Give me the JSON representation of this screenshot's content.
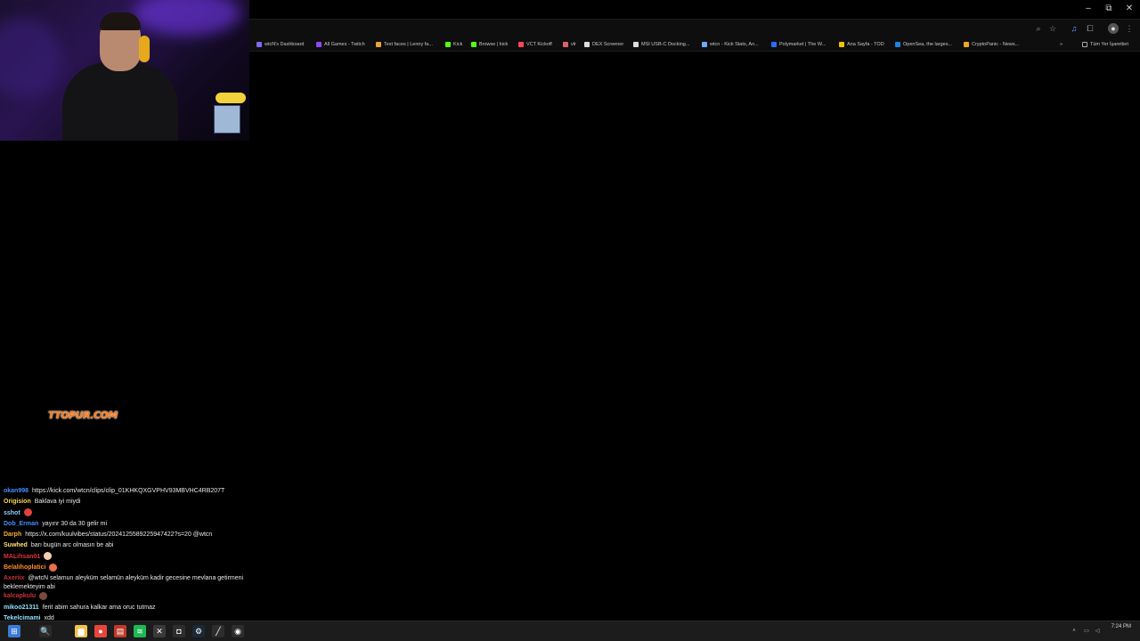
{
  "browser": {
    "window_controls": {
      "minimize": "–",
      "maximize": "⧉",
      "close": "✕"
    },
    "toolbar_icons": [
      "zoom-icon",
      "star-icon",
      "media-icon",
      "extensions-icon",
      "profile-icon",
      "menu-icon"
    ],
    "bookmarks": [
      {
        "label": "wtcN's Dashboard",
        "color": "#7c6af2"
      },
      {
        "label": "All Games - Twitch",
        "color": "#9146ff"
      },
      {
        "label": "Text faces | Lenny fa...",
        "color": "#e8a33a"
      },
      {
        "label": "Kick",
        "color": "#53fc18"
      },
      {
        "label": "Browse | kick",
        "color": "#53fc18"
      },
      {
        "label": "VCT Kickoff",
        "color": "#ff4655"
      },
      {
        "label": "vlr",
        "color": "#da626c"
      },
      {
        "label": "DEX Screener",
        "color": "#dcdcdc"
      },
      {
        "label": "MSI USB-C Docking...",
        "color": "#dcdcdc"
      },
      {
        "label": "wtcn - Kick Stats, An...",
        "color": "#6fa8ff"
      },
      {
        "label": "Polymarket | The W...",
        "color": "#2d6cf6"
      },
      {
        "label": "Ana Sayfa - TOD",
        "color": "#f2c200"
      },
      {
        "label": "OpenSea, the larges...",
        "color": "#2081e2"
      },
      {
        "label": "CryptoPanic - News...",
        "color": "#f5a623"
      }
    ],
    "bookmarks_overflow": "»",
    "all_bookmarks": "Tüm Yer İşaretleri"
  },
  "overlay": {
    "logo_text": "TTOPUR.COM"
  },
  "chat": {
    "messages": [
      {
        "user": "okan998",
        "color": "#4a8cff",
        "text": "https://kick.com/wtcn/clips/clip_01KHKQXGVPHV93MBVHC4RB207T"
      },
      {
        "user": "Origision",
        "color": "#ffd84a",
        "text": "Baklava iyi miydi"
      },
      {
        "user": "sshot",
        "color": "#8fd0ff",
        "text": "",
        "emote": "#e04040"
      },
      {
        "user": "Dob_Erman",
        "color": "#4a8cff",
        "text": "yayınr 30 da 30 gelir mi"
      },
      {
        "user": "Darph",
        "color": "#ffb03a",
        "text": "https://x.com/kuulvibes/status/2024125589225947422?s=20 @wtcn"
      },
      {
        "user": "Suwhed",
        "color": "#ffe06a",
        "text": "barı bugün arc olmasın be abi"
      },
      {
        "user": "MALihsan01",
        "color": "#e0303a",
        "text": "",
        "emote": "#f5d0b0"
      },
      {
        "user": "Belalihoplatici",
        "color": "#ff8a2a",
        "text": "",
        "emote": "#e8704a"
      },
      {
        "user": "Axeriix",
        "color": "#c8323a",
        "text": "@wtcN selamun aleyküm selamün aleyküm kadir gecesine mevlana getirmeni beklemekteyim abi",
        "wrap": true
      },
      {
        "user": "kalcapkulu",
        "color": "#c8323a",
        "text": "",
        "emote": "#7a4a3a"
      },
      {
        "user": "mikoo21311",
        "color": "#8fe0ff",
        "text": "ferit abim sahura kalkar ama oruc tutmaz"
      },
      {
        "user": "Tekelcimami",
        "color": "#8fe0ff",
        "text": "xdd"
      }
    ]
  },
  "taskbar": {
    "clock": "7:24 PM",
    "apps": [
      {
        "name": "start-icon",
        "glyph": "⊞",
        "color": "#3a7bd5"
      },
      {
        "name": "search-icon",
        "glyph": "🔍",
        "color": "#2a2a2a"
      },
      {
        "name": "folder-icon",
        "glyph": "▆",
        "color": "#f2c14e"
      },
      {
        "name": "chrome-icon",
        "glyph": "●",
        "color": "#e8453c"
      },
      {
        "name": "media-player-icon",
        "glyph": "▤",
        "color": "#c0392b"
      },
      {
        "name": "spotify-icon",
        "glyph": "≋",
        "color": "#1db954"
      },
      {
        "name": "xbox-icon",
        "glyph": "✕",
        "color": "#3a3a3a"
      },
      {
        "name": "app-icon",
        "glyph": "◘",
        "color": "#2d2d2d"
      },
      {
        "name": "steam-icon",
        "glyph": "⚙",
        "color": "#1b2838"
      },
      {
        "name": "pen-tool-icon",
        "glyph": "╱",
        "color": "#2d2d2d"
      },
      {
        "name": "obs-icon",
        "glyph": "◉",
        "color": "#2d2d2d"
      }
    ],
    "tray": [
      "chevron-up-icon",
      "network-icon",
      "speaker-icon",
      "battery-icon"
    ]
  }
}
